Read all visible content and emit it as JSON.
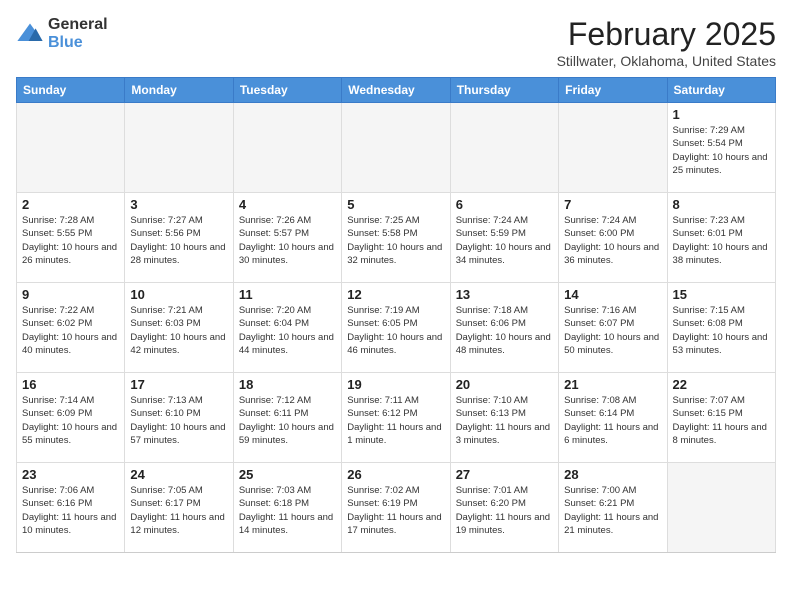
{
  "header": {
    "logo_general": "General",
    "logo_blue": "Blue",
    "month_title": "February 2025",
    "location": "Stillwater, Oklahoma, United States"
  },
  "days_of_week": [
    "Sunday",
    "Monday",
    "Tuesday",
    "Wednesday",
    "Thursday",
    "Friday",
    "Saturday"
  ],
  "weeks": [
    [
      {
        "day": "",
        "info": ""
      },
      {
        "day": "",
        "info": ""
      },
      {
        "day": "",
        "info": ""
      },
      {
        "day": "",
        "info": ""
      },
      {
        "day": "",
        "info": ""
      },
      {
        "day": "",
        "info": ""
      },
      {
        "day": "1",
        "info": "Sunrise: 7:29 AM\nSunset: 5:54 PM\nDaylight: 10 hours and 25 minutes."
      }
    ],
    [
      {
        "day": "2",
        "info": "Sunrise: 7:28 AM\nSunset: 5:55 PM\nDaylight: 10 hours and 26 minutes."
      },
      {
        "day": "3",
        "info": "Sunrise: 7:27 AM\nSunset: 5:56 PM\nDaylight: 10 hours and 28 minutes."
      },
      {
        "day": "4",
        "info": "Sunrise: 7:26 AM\nSunset: 5:57 PM\nDaylight: 10 hours and 30 minutes."
      },
      {
        "day": "5",
        "info": "Sunrise: 7:25 AM\nSunset: 5:58 PM\nDaylight: 10 hours and 32 minutes."
      },
      {
        "day": "6",
        "info": "Sunrise: 7:24 AM\nSunset: 5:59 PM\nDaylight: 10 hours and 34 minutes."
      },
      {
        "day": "7",
        "info": "Sunrise: 7:24 AM\nSunset: 6:00 PM\nDaylight: 10 hours and 36 minutes."
      },
      {
        "day": "8",
        "info": "Sunrise: 7:23 AM\nSunset: 6:01 PM\nDaylight: 10 hours and 38 minutes."
      }
    ],
    [
      {
        "day": "9",
        "info": "Sunrise: 7:22 AM\nSunset: 6:02 PM\nDaylight: 10 hours and 40 minutes."
      },
      {
        "day": "10",
        "info": "Sunrise: 7:21 AM\nSunset: 6:03 PM\nDaylight: 10 hours and 42 minutes."
      },
      {
        "day": "11",
        "info": "Sunrise: 7:20 AM\nSunset: 6:04 PM\nDaylight: 10 hours and 44 minutes."
      },
      {
        "day": "12",
        "info": "Sunrise: 7:19 AM\nSunset: 6:05 PM\nDaylight: 10 hours and 46 minutes."
      },
      {
        "day": "13",
        "info": "Sunrise: 7:18 AM\nSunset: 6:06 PM\nDaylight: 10 hours and 48 minutes."
      },
      {
        "day": "14",
        "info": "Sunrise: 7:16 AM\nSunset: 6:07 PM\nDaylight: 10 hours and 50 minutes."
      },
      {
        "day": "15",
        "info": "Sunrise: 7:15 AM\nSunset: 6:08 PM\nDaylight: 10 hours and 53 minutes."
      }
    ],
    [
      {
        "day": "16",
        "info": "Sunrise: 7:14 AM\nSunset: 6:09 PM\nDaylight: 10 hours and 55 minutes."
      },
      {
        "day": "17",
        "info": "Sunrise: 7:13 AM\nSunset: 6:10 PM\nDaylight: 10 hours and 57 minutes."
      },
      {
        "day": "18",
        "info": "Sunrise: 7:12 AM\nSunset: 6:11 PM\nDaylight: 10 hours and 59 minutes."
      },
      {
        "day": "19",
        "info": "Sunrise: 7:11 AM\nSunset: 6:12 PM\nDaylight: 11 hours and 1 minute."
      },
      {
        "day": "20",
        "info": "Sunrise: 7:10 AM\nSunset: 6:13 PM\nDaylight: 11 hours and 3 minutes."
      },
      {
        "day": "21",
        "info": "Sunrise: 7:08 AM\nSunset: 6:14 PM\nDaylight: 11 hours and 6 minutes."
      },
      {
        "day": "22",
        "info": "Sunrise: 7:07 AM\nSunset: 6:15 PM\nDaylight: 11 hours and 8 minutes."
      }
    ],
    [
      {
        "day": "23",
        "info": "Sunrise: 7:06 AM\nSunset: 6:16 PM\nDaylight: 11 hours and 10 minutes."
      },
      {
        "day": "24",
        "info": "Sunrise: 7:05 AM\nSunset: 6:17 PM\nDaylight: 11 hours and 12 minutes."
      },
      {
        "day": "25",
        "info": "Sunrise: 7:03 AM\nSunset: 6:18 PM\nDaylight: 11 hours and 14 minutes."
      },
      {
        "day": "26",
        "info": "Sunrise: 7:02 AM\nSunset: 6:19 PM\nDaylight: 11 hours and 17 minutes."
      },
      {
        "day": "27",
        "info": "Sunrise: 7:01 AM\nSunset: 6:20 PM\nDaylight: 11 hours and 19 minutes."
      },
      {
        "day": "28",
        "info": "Sunrise: 7:00 AM\nSunset: 6:21 PM\nDaylight: 11 hours and 21 minutes."
      },
      {
        "day": "",
        "info": ""
      }
    ]
  ]
}
